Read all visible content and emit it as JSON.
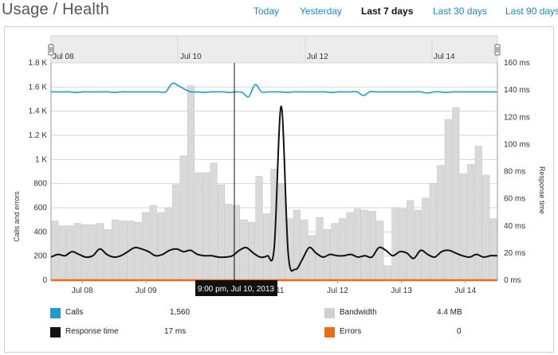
{
  "page_title": "Usage / Health",
  "time_ranges": [
    {
      "label": "Today",
      "active": false
    },
    {
      "label": "Yesterday",
      "active": false
    },
    {
      "label": "Last 7 days",
      "active": true
    },
    {
      "label": "Last 30 days",
      "active": false
    },
    {
      "label": "Last 90 days",
      "active": false
    }
  ],
  "navigator_labels": [
    "Jul 08",
    "Jul 10",
    "Jul 12",
    "Jul 14"
  ],
  "tooltip": "9:00 pm, Jul 10, 2013",
  "legend": [
    {
      "label": "Calls",
      "value": "1,560",
      "color": "#1a9bd1"
    },
    {
      "label": "Bandwidth",
      "value": "4.4 MB",
      "color": "#cfcfcf"
    },
    {
      "label": "Response time",
      "value": "17 ms",
      "color": "#111111"
    },
    {
      "label": "Errors",
      "value": "0",
      "color": "#f26a10"
    }
  ],
  "chart_data": {
    "type": "bar",
    "x_tick_labels": [
      "Jul 08",
      "Jul 09",
      "Jul 10",
      "Jul 11",
      "Jul 12",
      "Jul 13",
      "Jul 14"
    ],
    "ylabel": "Calls and errors",
    "y2label": "Response time",
    "y_ticks": [
      "0",
      "200",
      "400",
      "600",
      "800",
      "1 K",
      "1.2 K",
      "1.4 K",
      "1.6 K",
      "1.8 K"
    ],
    "y2_ticks": [
      "0 ms",
      "20 ms",
      "40 ms",
      "60 ms",
      "80 ms",
      "100 ms",
      "120 ms",
      "140 ms",
      "160 ms"
    ],
    "ylim": [
      0,
      1800
    ],
    "y2lim": [
      0,
      160
    ],
    "bandwidth_bars": [
      490,
      450,
      450,
      470,
      460,
      460,
      470,
      420,
      500,
      490,
      490,
      480,
      560,
      620,
      560,
      600,
      790,
      1030,
      1610,
      890,
      890,
      970,
      790,
      630,
      620,
      500,
      480,
      860,
      550,
      920,
      800,
      510,
      580,
      500,
      370,
      520,
      420,
      470,
      510,
      560,
      590,
      580,
      570,
      490,
      120,
      600,
      590,
      660,
      580,
      680,
      800,
      950,
      1330,
      1430,
      880,
      960,
      1110,
      870,
      510
    ],
    "series": [
      {
        "name": "Calls",
        "color": "#1a9bd1",
        "values": [
          1560,
          1560,
          1560,
          1560,
          1555,
          1560,
          1560,
          1560,
          1560,
          1560,
          1555,
          1560,
          1560,
          1560,
          1560,
          1560,
          1560,
          1560,
          1560,
          1630,
          1610,
          1580,
          1560,
          1560,
          1555,
          1560,
          1560,
          1560,
          1555,
          1560,
          1555,
          1520,
          1620,
          1560,
          1560,
          1560,
          1560,
          1555,
          1560,
          1560,
          1560,
          1560,
          1560,
          1560,
          1555,
          1560,
          1560,
          1560,
          1560,
          1530,
          1560,
          1560,
          1560,
          1560,
          1560,
          1560,
          1560,
          1560,
          1560,
          1550,
          1560,
          1560,
          1555,
          1560,
          1560,
          1560,
          1560,
          1560,
          1560,
          1560,
          1560
        ]
      },
      {
        "name": "Response time",
        "color": "#111111",
        "values": [
          17,
          19,
          18,
          21,
          19,
          17,
          18,
          23,
          19,
          17,
          18,
          21,
          24,
          23,
          21,
          18,
          19,
          22,
          23,
          21,
          22,
          19,
          18,
          18,
          17,
          17,
          18,
          22,
          24,
          20,
          17,
          18,
          24,
          128,
          20,
          8,
          15,
          24,
          20,
          17,
          19,
          18,
          18,
          19,
          17,
          18,
          17,
          24,
          22,
          18,
          21,
          20,
          16,
          22,
          19,
          17,
          21,
          22,
          20,
          18,
          17,
          19,
          17,
          18,
          18
        ]
      },
      {
        "name": "Errors",
        "color": "#f26a10",
        "values": [
          0,
          0,
          0,
          0,
          0,
          0,
          0,
          0,
          0,
          0,
          0,
          0,
          0,
          0,
          0,
          0,
          0,
          0,
          0,
          0,
          0,
          0,
          0,
          0,
          0,
          0,
          0,
          0,
          0,
          0,
          0,
          0,
          0,
          0,
          0,
          0,
          0,
          0,
          0,
          0
        ]
      }
    ]
  }
}
